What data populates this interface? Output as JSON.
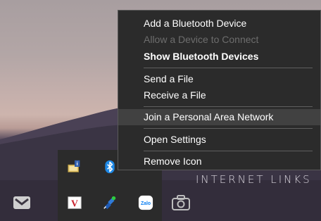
{
  "context_menu": {
    "items": [
      {
        "label": "Add a Bluetooth Device",
        "state": "normal"
      },
      {
        "label": "Allow a Device to Connect",
        "state": "disabled"
      },
      {
        "label": "Show Bluetooth Devices",
        "state": "default"
      },
      {
        "label": "Send a File",
        "state": "normal"
      },
      {
        "label": "Receive a File",
        "state": "normal"
      },
      {
        "label": "Join a Personal Area Network",
        "state": "highlighted"
      },
      {
        "label": "Open Settings",
        "state": "normal"
      },
      {
        "label": "Remove Icon",
        "state": "normal"
      }
    ]
  },
  "tray_icons": [
    "network-info-icon",
    "bluetooth-icon",
    "v-app-icon",
    "network-status-icon",
    "zalo-icon"
  ],
  "tray_labels": {
    "zalo": "Zalo",
    "v_app": "V"
  },
  "taskbar_icons": [
    "mail-icon",
    "camera-icon"
  ],
  "wallpaper": {
    "watermark": "INTERNET LINKS"
  },
  "colors": {
    "menu_bg": "#2b2b2b",
    "menu_hover": "#414141",
    "disabled_text": "#6d6d6d",
    "bluetooth": "#1e88e5",
    "zalo": "#0b7ff2"
  }
}
